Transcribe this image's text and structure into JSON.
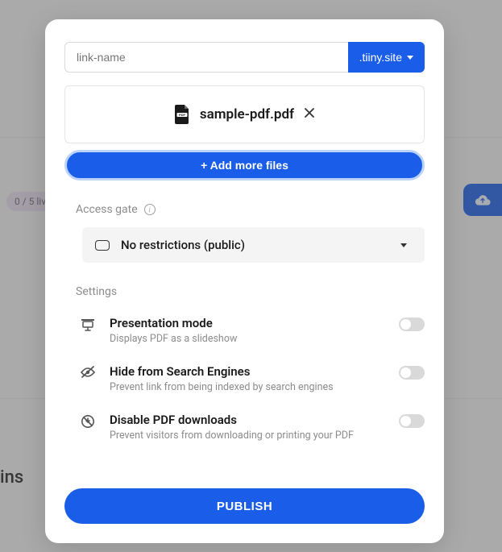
{
  "background": {
    "usage_pill": "0 / 5 liv",
    "heading_fragment": "ins"
  },
  "link": {
    "placeholder": "link-name",
    "value": "",
    "domain": ".tiiny.site"
  },
  "file": {
    "name": "sample-pdf.pdf"
  },
  "add_more_label": "+ Add more files",
  "access": {
    "label": "Access gate",
    "selected": "No restrictions (public)"
  },
  "settings": {
    "label": "Settings",
    "items": [
      {
        "title": "Presentation mode",
        "desc": "Displays PDF as a slideshow",
        "on": false
      },
      {
        "title": "Hide from Search Engines",
        "desc": "Prevent link from being indexed by search engines",
        "on": false
      },
      {
        "title": "Disable PDF downloads",
        "desc": "Prevent visitors from downloading or printing your PDF",
        "on": false
      }
    ]
  },
  "publish_label": "PUBLISH"
}
